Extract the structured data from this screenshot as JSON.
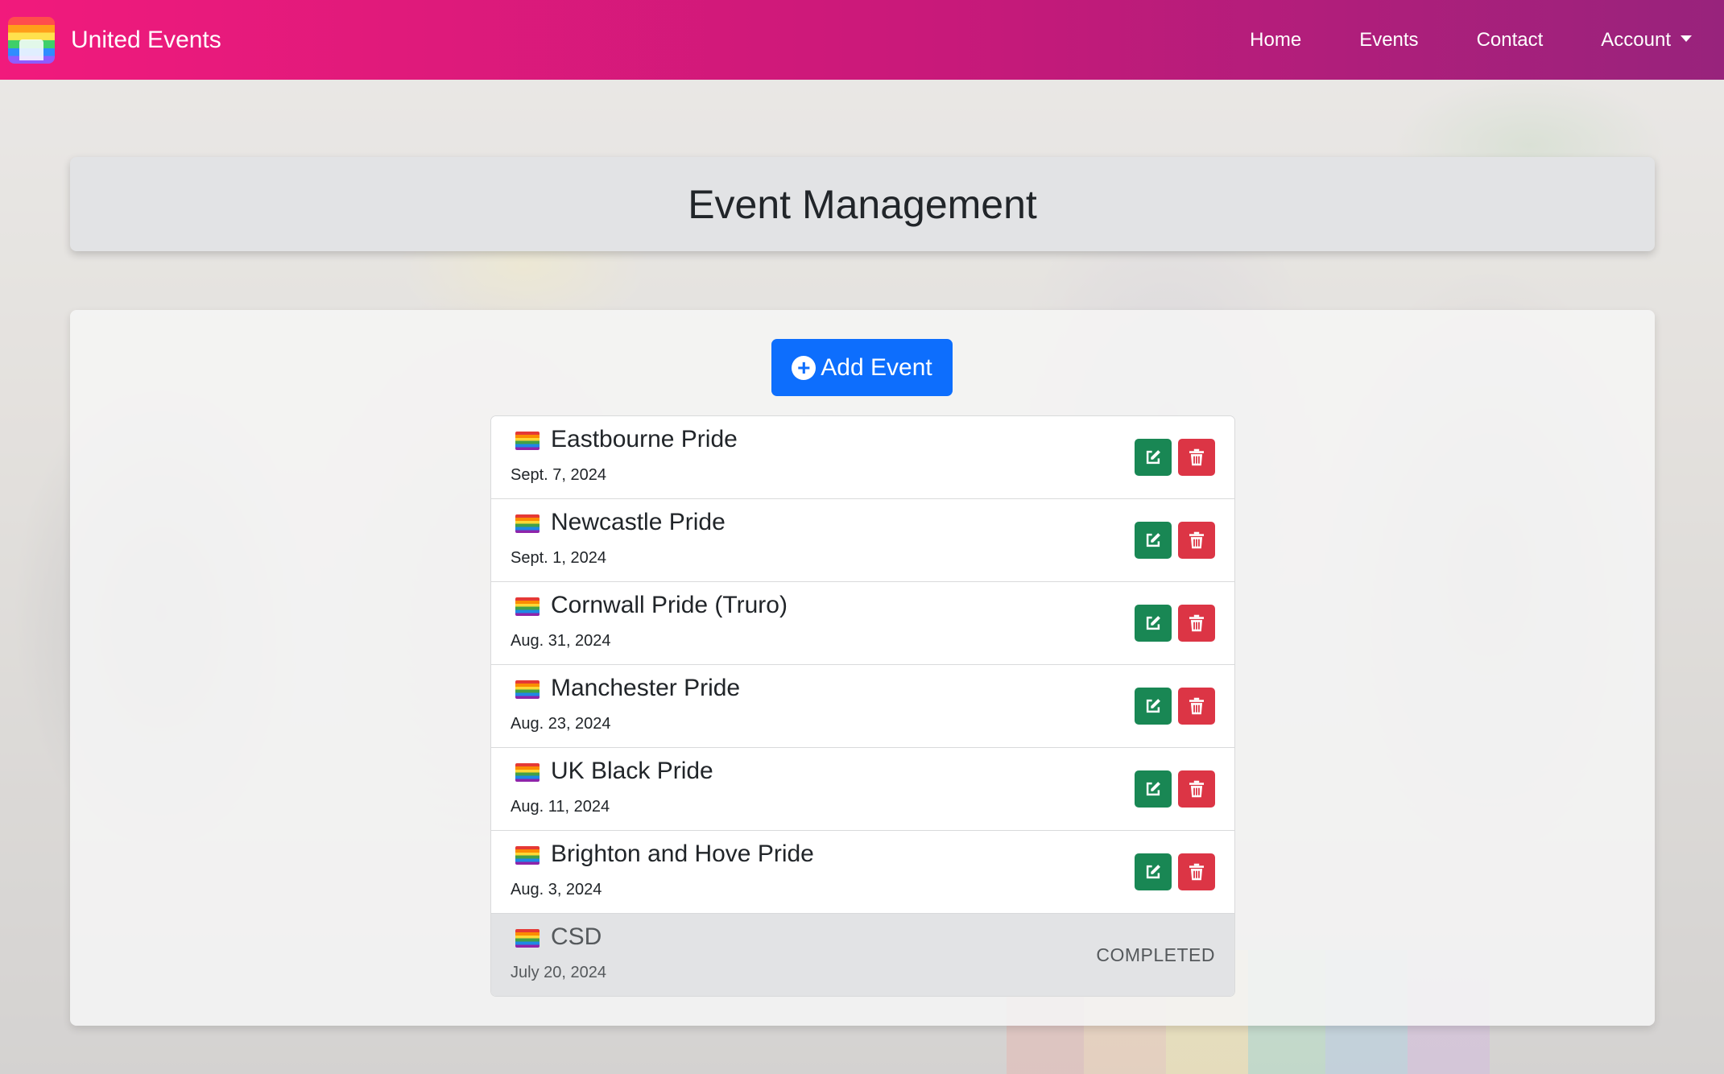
{
  "brand": {
    "name": "United Events"
  },
  "nav": {
    "home": "Home",
    "events": "Events",
    "contact": "Contact",
    "account": "Account"
  },
  "page": {
    "title": "Event Management",
    "add_button": "Add Event"
  },
  "events": [
    {
      "title": "Eastbourne Pride",
      "date": "Sept. 7, 2024"
    },
    {
      "title": "Newcastle Pride",
      "date": "Sept. 1, 2024"
    },
    {
      "title": "Cornwall Pride (Truro)",
      "date": "Aug. 31, 2024"
    },
    {
      "title": "Manchester Pride",
      "date": "Aug. 23, 2024"
    },
    {
      "title": "UK Black Pride",
      "date": "Aug. 11, 2024"
    },
    {
      "title": "Brighton and Hove Pride",
      "date": "Aug. 3, 2024"
    },
    {
      "title": "CSD",
      "date": "July 20, 2024",
      "status": "COMPLETED"
    }
  ],
  "colors": {
    "navbar_start": "#f11a7c",
    "navbar_end": "#98237c",
    "primary": "#0d6efd",
    "edit": "#198754",
    "delete": "#dc3545"
  },
  "icons": {
    "add": "plus-circle-icon",
    "edit": "pencil-square-icon",
    "delete": "trash-icon",
    "flag": "rainbow-flag-icon",
    "account": "caret-down-icon"
  }
}
